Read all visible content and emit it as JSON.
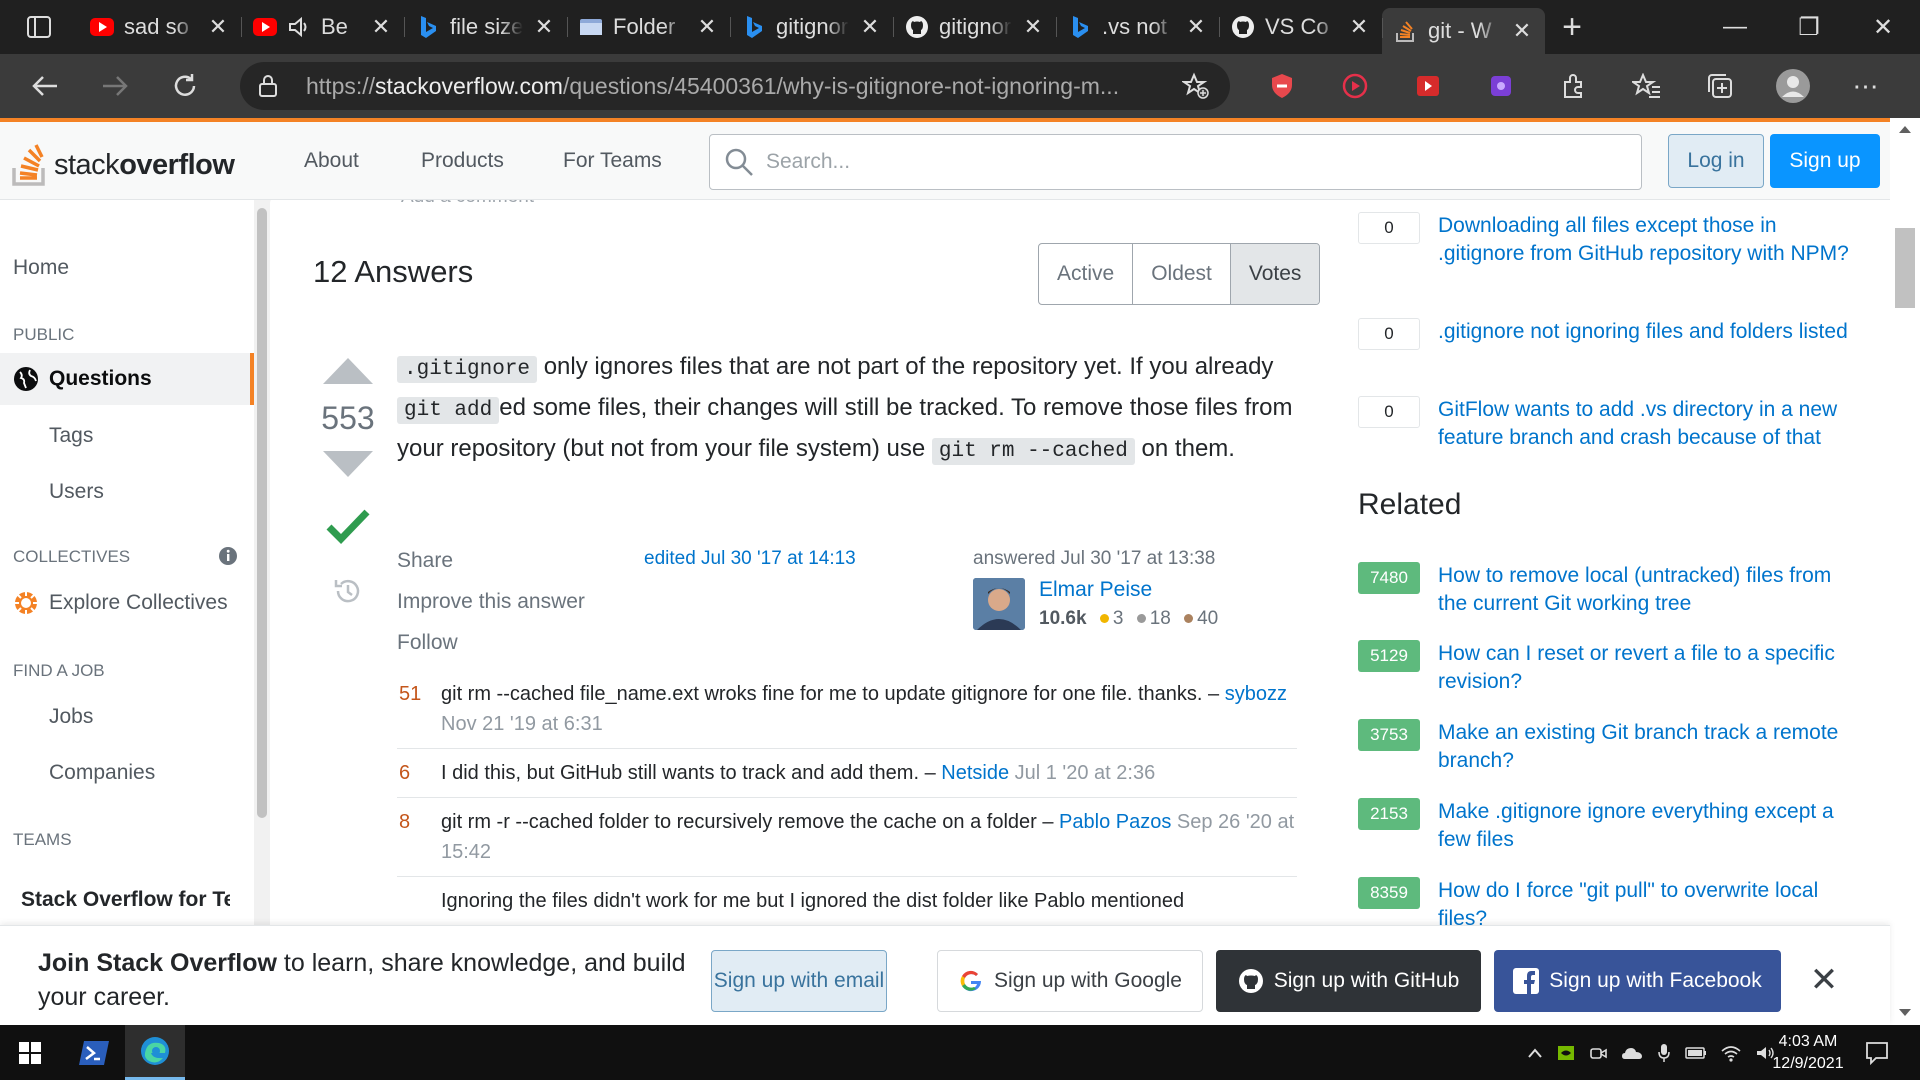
{
  "browser": {
    "tabs": [
      {
        "title": "sad so",
        "icon": "youtube-icon"
      },
      {
        "title": "Be",
        "icon": "youtube-icon"
      },
      {
        "title": "file size",
        "icon": "bing-icon"
      },
      {
        "title": "Folder",
        "icon": "folder-icon"
      },
      {
        "title": "gitignore",
        "icon": "bing-icon"
      },
      {
        "title": "gitignore",
        "icon": "github-icon"
      },
      {
        "title": ".vs not",
        "icon": "bing-icon"
      },
      {
        "title": "VS Co",
        "icon": "github-icon"
      },
      {
        "title": "git - W",
        "icon": "stackoverflow-icon"
      }
    ],
    "url_prefix": "https://",
    "url_domain": "stackoverflow.com",
    "url_path": "/questions/45400361/why-is-gitignore-not-ignoring-m..."
  },
  "header": {
    "logo_light": "stack",
    "logo_bold": "overflow",
    "nav": [
      "About",
      "Products",
      "For Teams"
    ],
    "search_placeholder": "Search...",
    "login": "Log in",
    "signup": "Sign up"
  },
  "sidebar": {
    "home": "Home",
    "public_caption": "PUBLIC",
    "questions": "Questions",
    "tags": "Tags",
    "users": "Users",
    "collectives_caption": "COLLECTIVES",
    "explore_collectives": "Explore Collectives",
    "findjob_caption": "FIND A JOB",
    "jobs": "Jobs",
    "companies": "Companies",
    "teams_caption": "TEAMS",
    "teams_promo": "Stack Overflow for Teams – Collaborate"
  },
  "main": {
    "add_comment": "Add a comment",
    "answers_heading": "12 Answers",
    "sort_tabs": [
      "Active",
      "Oldest",
      "Votes"
    ],
    "vote_count": "553",
    "answer": {
      "code1": ".gitignore",
      "t1": " only ignores files that are not part of the repository yet. If you already ",
      "code2": "git add",
      "t2": "ed some files, their changes will still be tracked. To remove those files from your repository (but not from your file system) use ",
      "code3": "git rm --cached",
      "t3": " on them."
    },
    "menu": [
      "Share",
      "Improve this answer",
      "Follow"
    ],
    "edited": "edited Jul 30 '17 at 14:13",
    "answered": "answered Jul 30 '17 at 13:38",
    "user_name": "Elmar Peise",
    "user_rep": "10.6k",
    "gold": "3",
    "silver": "18",
    "bronze": "40",
    "comments": [
      {
        "score": "51",
        "text": "git rm --cached file_name.ext wroks fine for me to update gitignore for one file. thanks. – ",
        "user": "sybozz",
        "date": "Nov 21 '19 at 6:31"
      },
      {
        "score": "6",
        "text": "I did this, but GitHub still wants to track and add them. – ",
        "user": "Netside",
        "date": "Jul 1 '20 at 2:36"
      },
      {
        "score": "8",
        "text": "git rm -r --cached folder to recursively remove the cache on a folder – ",
        "user": "Pablo Pazos",
        "date": "Sep 26 '20 at 15:42"
      },
      {
        "score": "",
        "text": "Ignoring the files didn't work for me but I ignored the dist folder like Pablo mentioned",
        "user": "",
        "date": ""
      }
    ]
  },
  "rightbar": {
    "linked": [
      {
        "score": "0",
        "title": "Downloading all files except those in .gitignore from GitHub repository with NPM?"
      },
      {
        "score": "0",
        "title": ".gitignore not ignoring files and folders listed"
      },
      {
        "score": "0",
        "title": "GitFlow wants to add .vs directory in a new feature branch and crash because of that"
      }
    ],
    "related_heading": "Related",
    "related": [
      {
        "score": "7480",
        "title": "How to remove local (untracked) files from the current Git working tree"
      },
      {
        "score": "5129",
        "title": "How can I reset or revert a file to a specific revision?"
      },
      {
        "score": "3753",
        "title": "Make an existing Git branch track a remote branch?"
      },
      {
        "score": "2153",
        "title": "Make .gitignore ignore everything except a few files"
      },
      {
        "score": "8359",
        "title": "How do I force \"git pull\" to overwrite local files?"
      }
    ]
  },
  "banner": {
    "bold": "Join Stack Overflow",
    "rest": " to learn, share knowledge, and build your career.",
    "email": "Sign up with email",
    "google": "Sign up with Google",
    "github": "Sign up with GitHub",
    "facebook": "Sign up with Facebook"
  },
  "taskbar": {
    "time": "4:03 AM",
    "date": "12/9/2021"
  },
  "colors": {
    "so_orange": "#f48225",
    "link": "#0074cc",
    "accepted": "#5eba7d",
    "primary_button": "#0a95ff"
  }
}
